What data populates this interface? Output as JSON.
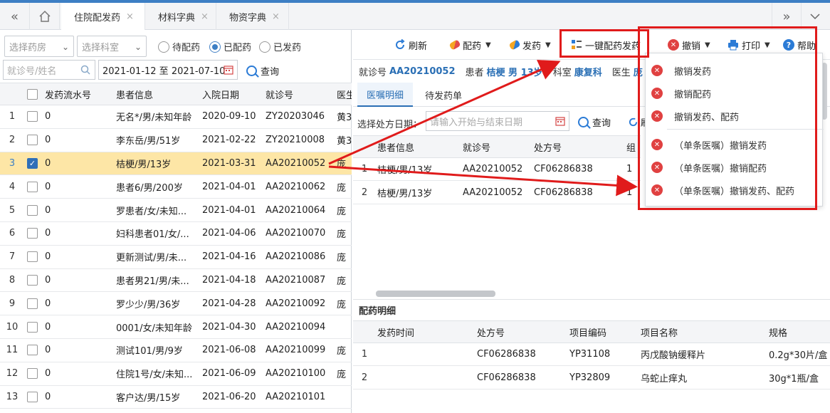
{
  "tabbar": {
    "tabs": [
      {
        "label": "住院配发药",
        "active": true
      },
      {
        "label": "材料字典",
        "active": false
      },
      {
        "label": "物资字典",
        "active": false
      }
    ],
    "close_glyph": "×",
    "nav_back_icon": "«",
    "nav_forward_icon": "»"
  },
  "filters": {
    "pharmacy_placeholder": "选择药房",
    "dept_placeholder": "选择科室",
    "radios": [
      {
        "label": "待配药",
        "checked": false
      },
      {
        "label": "已配药",
        "checked": true
      },
      {
        "label": "已发药",
        "checked": false
      }
    ],
    "search_placeholder": "就诊号/姓名",
    "date_range": "2021-01-12 至 2021-07-10",
    "query_label": "查询"
  },
  "left_table": {
    "headers": [
      "发药流水号",
      "患者信息",
      "入院日期",
      "就诊号",
      "医生"
    ],
    "rows": [
      {
        "idx": "1",
        "serial": "0",
        "patient": "无名*/男/未知年龄",
        "date": "2020-09-10",
        "visit": "ZY20203046",
        "doctor": "黄3",
        "checked": false
      },
      {
        "idx": "2",
        "serial": "0",
        "patient": "李东岳/男/51岁",
        "date": "2021-02-22",
        "visit": "ZY20210008",
        "doctor": "黄3",
        "checked": false
      },
      {
        "idx": "3",
        "serial": "0",
        "patient": "桔梗/男/13岁",
        "date": "2021-03-31",
        "visit": "AA20210052",
        "doctor": "庞",
        "checked": true
      },
      {
        "idx": "4",
        "serial": "0",
        "patient": "患者6/男/200岁",
        "date": "2021-04-01",
        "visit": "AA20210062",
        "doctor": "庞",
        "checked": false
      },
      {
        "idx": "5",
        "serial": "0",
        "patient": "罗患者/女/未知...",
        "date": "2021-04-01",
        "visit": "AA20210064",
        "doctor": "庞",
        "checked": false
      },
      {
        "idx": "6",
        "serial": "0",
        "patient": "妇科患者01/女/...",
        "date": "2021-04-06",
        "visit": "AA20210070",
        "doctor": "庞",
        "checked": false
      },
      {
        "idx": "7",
        "serial": "0",
        "patient": "更新测试/男/未...",
        "date": "2021-04-16",
        "visit": "AA20210086",
        "doctor": "庞",
        "checked": false
      },
      {
        "idx": "8",
        "serial": "0",
        "patient": "患者男21/男/未...",
        "date": "2021-04-18",
        "visit": "AA20210087",
        "doctor": "庞",
        "checked": false
      },
      {
        "idx": "9",
        "serial": "0",
        "patient": "罗少少/男/36岁",
        "date": "2021-04-28",
        "visit": "AA20210092",
        "doctor": "庞",
        "checked": false
      },
      {
        "idx": "10",
        "serial": "0",
        "patient": "0001/女/未知年龄",
        "date": "2021-04-30",
        "visit": "AA20210094",
        "doctor": "",
        "checked": false
      },
      {
        "idx": "11",
        "serial": "0",
        "patient": "测试101/男/9岁",
        "date": "2021-06-08",
        "visit": "AA20210099",
        "doctor": "庞",
        "checked": false
      },
      {
        "idx": "12",
        "serial": "0",
        "patient": "住院1号/女/未知...",
        "date": "2021-06-09",
        "visit": "AA20210100",
        "doctor": "庞",
        "checked": false
      },
      {
        "idx": "13",
        "serial": "0",
        "patient": "客户达/男/15岁",
        "date": "2021-06-20",
        "visit": "AA20210101",
        "doctor": "",
        "checked": false
      }
    ]
  },
  "toolbar": {
    "refresh": "刷新",
    "dispense_prep": "配药",
    "dispense": "发药",
    "one_click": "一键配药发药",
    "revoke": "撤销",
    "print": "打印",
    "help": "帮助"
  },
  "info": {
    "visit_label": "就诊号",
    "visit_value": "AA20210052",
    "patient_label": "患者",
    "patient_value": "桔梗 男 13岁",
    "dept_label": "科室",
    "dept_value": "康复科",
    "doctor_label": "医生",
    "doctor_value": "庞"
  },
  "subtabs": [
    "医嘱明细",
    "待发药单"
  ],
  "rx_filter": {
    "label": "选择处方日期：",
    "placeholder": "请输入开始与结束日期",
    "query": "查询",
    "refresh": "刷"
  },
  "rx_table": {
    "headers": [
      "患者信息",
      "就诊号",
      "处方号",
      "组"
    ],
    "rows": [
      {
        "idx": "1",
        "patient": "桔梗/男/13岁",
        "visit": "AA20210052",
        "rx": "CF06286838",
        "group": "1"
      },
      {
        "idx": "2",
        "patient": "桔梗/男/13岁",
        "visit": "AA20210052",
        "rx": "CF06286838",
        "group": "1"
      }
    ]
  },
  "detail": {
    "title": "配药明细",
    "headers": [
      "发药时间",
      "处方号",
      "项目编码",
      "项目名称",
      "规格"
    ],
    "rows": [
      {
        "idx": "1",
        "time": "",
        "rx": "CF06286838",
        "code": "YP31108",
        "name": "丙戊酸钠缓释片",
        "spec": "0.2g*30片/盒"
      },
      {
        "idx": "2",
        "time": "",
        "rx": "CF06286838",
        "code": "YP32809",
        "name": "乌蛇止痒丸",
        "spec": "30g*1瓶/盒"
      }
    ]
  },
  "revoke_menu": [
    "撤销发药",
    "撤销配药",
    "撤销发药、配药",
    "（单条医嘱）撤销发药",
    "（单条医嘱）撤销配药",
    "（单条医嘱）撤销发药、配药"
  ],
  "colors": {
    "accent": "#3d7fc4",
    "highlight_row": "#fde6a6",
    "annotation_red": "#e01b1b",
    "link_blue": "#2a6fb5"
  }
}
